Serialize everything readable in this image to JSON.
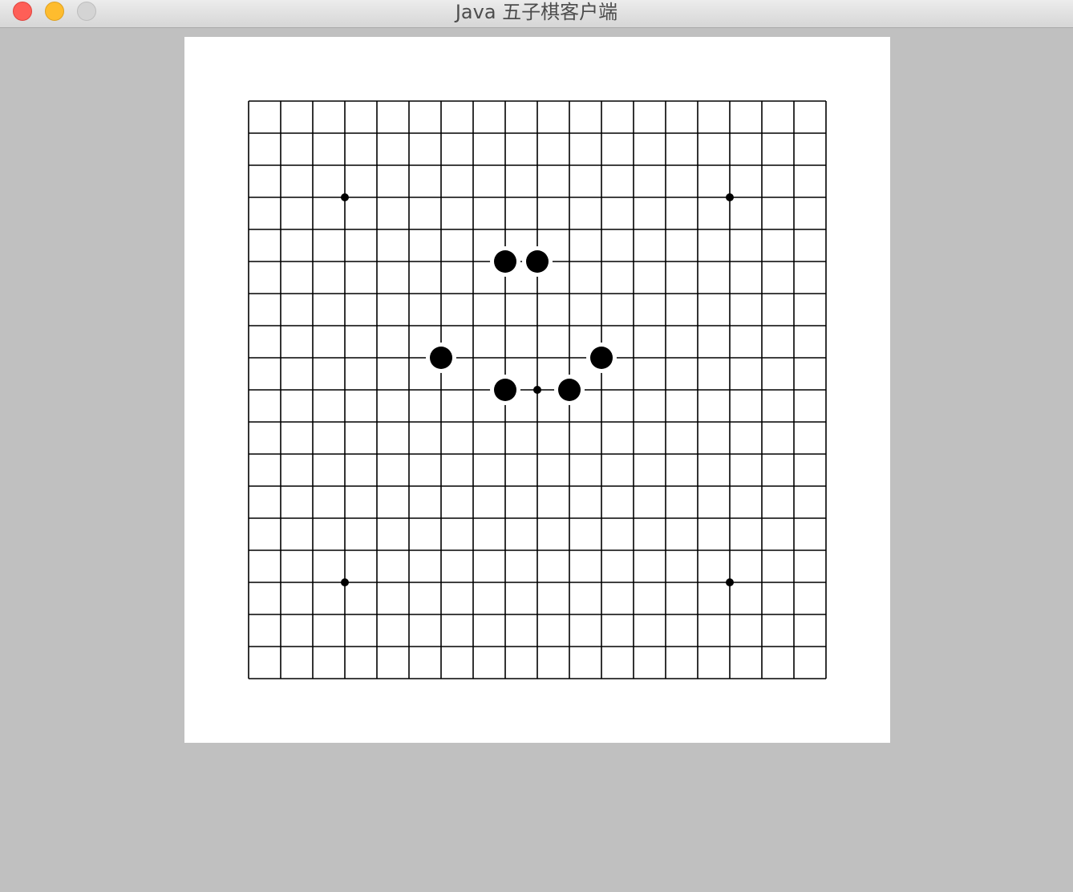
{
  "window": {
    "title": "Java 五子棋客户端"
  },
  "board": {
    "size": 19,
    "line_color": "#000000",
    "background_color": "#ffffff",
    "star_points": [
      [
        3,
        3
      ],
      [
        15,
        3
      ],
      [
        9,
        9
      ],
      [
        3,
        15
      ],
      [
        15,
        15
      ]
    ],
    "stones": [
      {
        "col": 8,
        "row": 5,
        "color": "black"
      },
      {
        "col": 9,
        "row": 5,
        "color": "black"
      },
      {
        "col": 6,
        "row": 8,
        "color": "black"
      },
      {
        "col": 11,
        "row": 8,
        "color": "black"
      },
      {
        "col": 8,
        "row": 9,
        "color": "black"
      },
      {
        "col": 10,
        "row": 9,
        "color": "black"
      }
    ]
  }
}
